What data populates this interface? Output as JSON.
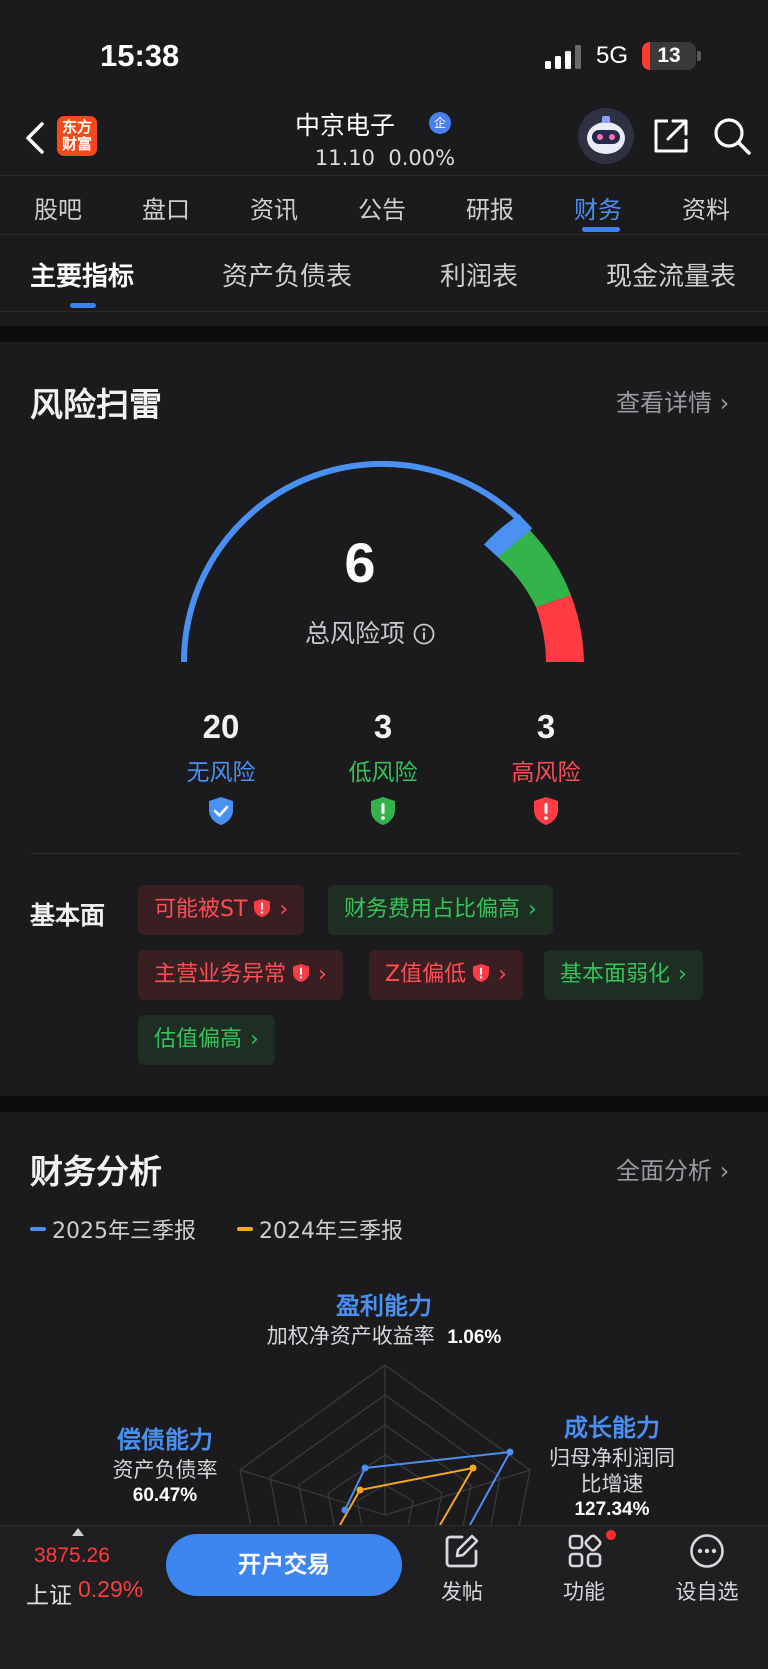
{
  "status_bar": {
    "time": "15:38",
    "network": "5G",
    "battery": "13"
  },
  "header": {
    "logo_text": "东方\n财富",
    "stock_name": "中京电子",
    "verified_badge": "企",
    "price": "11.10",
    "change": "0.00%",
    "icons": [
      "back-icon",
      "robot-avatar",
      "share-icon",
      "search-icon"
    ]
  },
  "tabs": [
    {
      "label": "股吧"
    },
    {
      "label": "盘口"
    },
    {
      "label": "资讯"
    },
    {
      "label": "公告"
    },
    {
      "label": "研报"
    },
    {
      "label": "财务",
      "active": true
    },
    {
      "label": "资料"
    }
  ],
  "subtabs": [
    {
      "label": "主要指标",
      "active": true
    },
    {
      "label": "资产负债表"
    },
    {
      "label": "利润表"
    },
    {
      "label": "现金流量表"
    }
  ],
  "risk": {
    "title": "风险扫雷",
    "more": "查看详情 ›",
    "total": "6",
    "total_label": "总风险项",
    "colors": {
      "none": "#4a8ff2",
      "low": "#34b34a",
      "high": "#ff3b44"
    },
    "counts": [
      {
        "value": "20",
        "label": "无风险",
        "color": "#4a8ff2"
      },
      {
        "value": "3",
        "label": "低风险",
        "color": "#36c25a"
      },
      {
        "value": "3",
        "label": "高风险",
        "color": "#ff4d55"
      }
    ],
    "fundamentals_label": "基本面",
    "tags": [
      {
        "text": "可能被ST",
        "level": "high"
      },
      {
        "text": "财务费用占比偏高",
        "level": "low"
      },
      {
        "text": "主营业务异常",
        "level": "high"
      },
      {
        "text": "Z值偏低",
        "level": "high"
      },
      {
        "text": "基本面弱化",
        "level": "low"
      },
      {
        "text": "估值偏高",
        "level": "low"
      }
    ],
    "chevron": "›"
  },
  "finance": {
    "title": "财务分析",
    "more": "全面分析 ›",
    "legend": [
      {
        "label": "2025年三季报",
        "color": "#4a8ff2"
      },
      {
        "label": "2024年三季报",
        "color": "#f5a623"
      }
    ],
    "profit": {
      "title": "盈利能力",
      "metric": "加权净资产收益率",
      "value": "1.06%"
    },
    "growth": {
      "title": "成长能力",
      "metric_line1": "归母净利润同",
      "metric_line2": "比增速",
      "value": "127.34%"
    },
    "solvency": {
      "title": "偿债能力",
      "metric": "资产负债率",
      "value": "60.47%"
    }
  },
  "bottom_bar": {
    "index_value": "3875.26",
    "index_name": "上证",
    "index_change": "0.29%",
    "trade_button": "开户交易",
    "items": [
      {
        "label": "发帖",
        "icon": "edit-icon"
      },
      {
        "label": "功能",
        "icon": "apps-icon"
      },
      {
        "label": "设自选",
        "icon": "more-icon"
      }
    ]
  }
}
